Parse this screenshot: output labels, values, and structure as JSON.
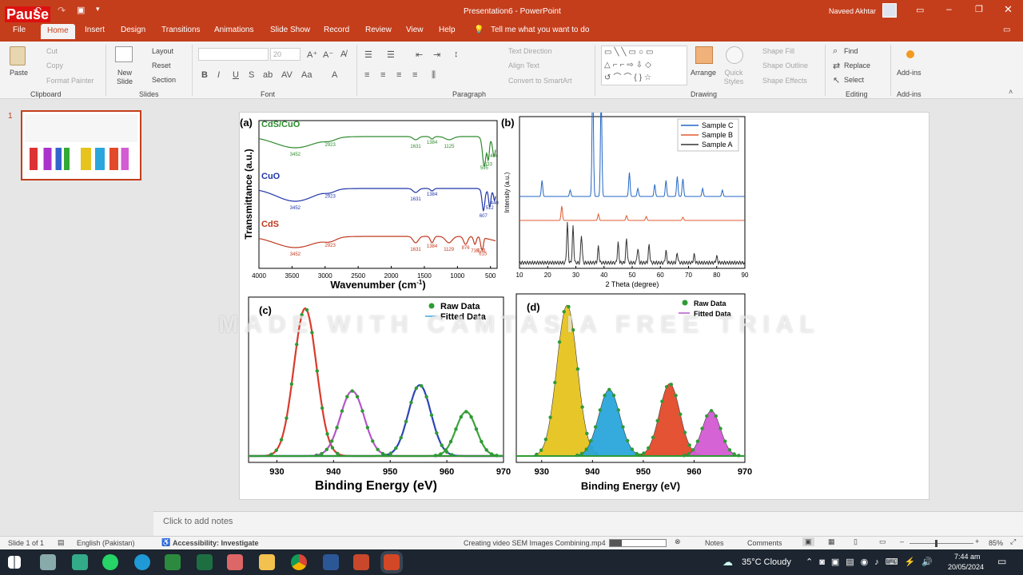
{
  "window": {
    "title": "Presentation6  -  PowerPoint",
    "user": "Naveed Akhtar",
    "pause_badge": "Pause"
  },
  "tabs": [
    "File",
    "Home",
    "Insert",
    "Design",
    "Transitions",
    "Animations",
    "Slide Show",
    "Record",
    "Review",
    "View",
    "Help"
  ],
  "tell_me": "Tell me what you want to do",
  "ribbon": {
    "clipboard": {
      "paste": "Paste",
      "cut": "Cut",
      "copy": "Copy",
      "format_painter": "Format Painter",
      "group": "Clipboard"
    },
    "slides": {
      "new_slide": "New Slide",
      "layout": "Layout",
      "reset": "Reset",
      "section": "Section",
      "group": "Slides"
    },
    "font": {
      "size": "20",
      "group": "Font"
    },
    "paragraph": {
      "text_direction": "Text Direction",
      "align_text": "Align Text",
      "convert": "Convert to SmartArt",
      "group": "Paragraph"
    },
    "drawing": {
      "arrange": "Arrange",
      "quick_styles": "Quick Styles",
      "shape_fill": "Shape Fill",
      "shape_outline": "Shape Outline",
      "shape_effects": "Shape Effects",
      "group": "Drawing"
    },
    "editing": {
      "find": "Find",
      "replace": "Replace",
      "select": "Select",
      "group": "Editing"
    },
    "addins": {
      "label": "Add-ins",
      "group": "Add-ins"
    }
  },
  "thumbnail_number": "1",
  "figure": {
    "panel_a": {
      "label": "(a)",
      "series": [
        {
          "name": "CdS/CuO",
          "color": "#2e8b2e",
          "peaks": [
            "3452",
            "2923",
            "1631",
            "1384",
            "1125",
            "595",
            "533",
            "446"
          ]
        },
        {
          "name": "CuO",
          "color": "#1f35a8",
          "peaks": [
            "3452",
            "2923",
            "1631",
            "1384",
            "607",
            "512",
            "440"
          ]
        },
        {
          "name": "CdS",
          "color": "#c0391f",
          "peaks": [
            "3452",
            "2923",
            "1631",
            "1384",
            "1129",
            "876",
            "735",
            "638",
            "615"
          ]
        }
      ],
      "ylabel": "Transmittance (a.u.)",
      "xlabel": "Wavenumber (cm",
      "xlabel_sup": "-1",
      "xlabel_end": ")",
      "xticks": [
        "4000",
        "3500",
        "3000",
        "2500",
        "2000",
        "1500",
        "1000",
        "500"
      ]
    },
    "panel_b": {
      "label": "(b)",
      "legend": [
        {
          "name": "Sample C",
          "color": "#2166c4"
        },
        {
          "name": "Sample B",
          "color": "#e05a30"
        },
        {
          "name": "Sample A",
          "color": "#333333"
        }
      ],
      "ylabel": "Intensity (a.u.)",
      "xlabel": "2 Theta (degree)",
      "xticks": [
        "10",
        "20",
        "30",
        "40",
        "50",
        "60",
        "70",
        "80",
        "90"
      ]
    },
    "panel_c": {
      "label": "(c)",
      "legend": [
        "Raw Data",
        "Fitted Data"
      ],
      "xlabel": "Binding Energy (eV)",
      "xticks": [
        "930",
        "940",
        "950",
        "960",
        "970"
      ]
    },
    "panel_d": {
      "label": "(d)",
      "legend": [
        "Raw Data",
        "Fitted Data"
      ],
      "xlabel": "Binding Energy (eV)",
      "xticks": [
        "930",
        "940",
        "950",
        "960",
        "970"
      ]
    }
  },
  "watermark": "MADE WITH CAMTASIA FREE TRIAL",
  "notes_placeholder": "Click to add notes",
  "status": {
    "slide": "Slide 1 of 1",
    "language": "English (Pakistan)",
    "accessibility": "Accessibility: Investigate",
    "export": "Creating video SEM Images Combining.mp4",
    "notes": "Notes",
    "comments": "Comments",
    "zoom": "85%"
  },
  "taskbar": {
    "weather": "35°C  Cloudy",
    "time": "7:44 am",
    "date": "20/05/2024"
  }
}
